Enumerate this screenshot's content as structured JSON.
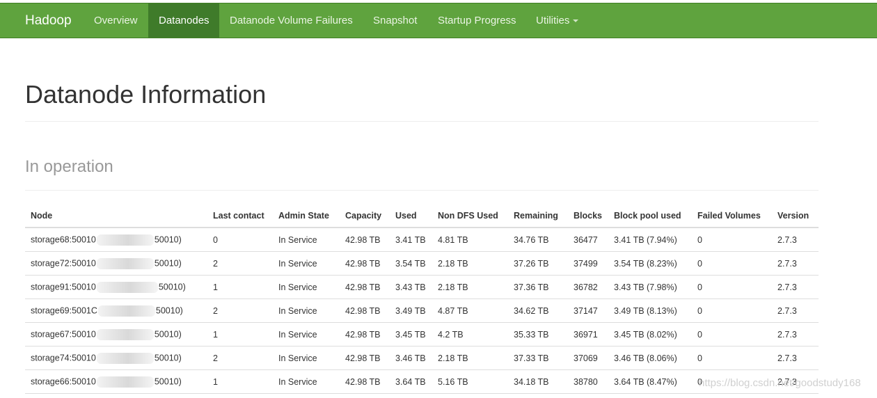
{
  "navbar": {
    "brand": "Hadoop",
    "items": [
      {
        "label": "Overview"
      },
      {
        "label": "Datanodes"
      },
      {
        "label": "Datanode Volume Failures"
      },
      {
        "label": "Snapshot"
      },
      {
        "label": "Startup Progress"
      },
      {
        "label": "Utilities"
      }
    ]
  },
  "page": {
    "title": "Datanode Information",
    "section": "In operation"
  },
  "table": {
    "headers": [
      "Node",
      "Last contact",
      "Admin State",
      "Capacity",
      "Used",
      "Non DFS Used",
      "Remaining",
      "Blocks",
      "Block pool used",
      "Failed Volumes",
      "Version"
    ],
    "rows": [
      {
        "node_prefix": "storage68:50010",
        "node_suffix": "50010)",
        "last_contact": "0",
        "admin_state": "In Service",
        "capacity": "42.98 TB",
        "used": "3.41 TB",
        "non_dfs_used": "4.81 TB",
        "remaining": "34.76 TB",
        "blocks": "36477",
        "block_pool_used": "3.41 TB (7.94%)",
        "failed_volumes": "0",
        "version": "2.7.3"
      },
      {
        "node_prefix": "storage72:50010",
        "node_suffix": "50010)",
        "last_contact": "2",
        "admin_state": "In Service",
        "capacity": "42.98 TB",
        "used": "3.54 TB",
        "non_dfs_used": "2.18 TB",
        "remaining": "37.26 TB",
        "blocks": "37499",
        "block_pool_used": "3.54 TB (8.23%)",
        "failed_volumes": "0",
        "version": "2.7.3"
      },
      {
        "node_prefix": "storage91:50010",
        "node_suffix": "50010)",
        "last_contact": "1",
        "admin_state": "In Service",
        "capacity": "42.98 TB",
        "used": "3.43 TB",
        "non_dfs_used": "2.18 TB",
        "remaining": "37.36 TB",
        "blocks": "36782",
        "block_pool_used": "3.43 TB (7.98%)",
        "failed_volumes": "0",
        "version": "2.7.3"
      },
      {
        "node_prefix": "storage69:5001C",
        "node_suffix": "50010)",
        "last_contact": "2",
        "admin_state": "In Service",
        "capacity": "42.98 TB",
        "used": "3.49 TB",
        "non_dfs_used": "4.87 TB",
        "remaining": "34.62 TB",
        "blocks": "37147",
        "block_pool_used": "3.49 TB (8.13%)",
        "failed_volumes": "0",
        "version": "2.7.3"
      },
      {
        "node_prefix": "storage67:50010",
        "node_suffix": "50010)",
        "last_contact": "1",
        "admin_state": "In Service",
        "capacity": "42.98 TB",
        "used": "3.45 TB",
        "non_dfs_used": "4.2 TB",
        "remaining": "35.33 TB",
        "blocks": "36971",
        "block_pool_used": "3.45 TB (8.02%)",
        "failed_volumes": "0",
        "version": "2.7.3"
      },
      {
        "node_prefix": "storage74:50010",
        "node_suffix": "50010)",
        "last_contact": "2",
        "admin_state": "In Service",
        "capacity": "42.98 TB",
        "used": "3.46 TB",
        "non_dfs_used": "2.18 TB",
        "remaining": "37.33 TB",
        "blocks": "37069",
        "block_pool_used": "3.46 TB (8.06%)",
        "failed_volumes": "0",
        "version": "2.7.3"
      },
      {
        "node_prefix": "storage66:50010",
        "node_suffix": "50010)",
        "last_contact": "1",
        "admin_state": "In Service",
        "capacity": "42.98 TB",
        "used": "3.64 TB",
        "non_dfs_used": "5.16 TB",
        "remaining": "34.18 TB",
        "blocks": "38780",
        "block_pool_used": "3.64 TB (8.47%)",
        "failed_volumes": "0",
        "version": "2.7.3"
      }
    ]
  },
  "watermark": "https://blog.csdn.net/goodstudy168",
  "colors": {
    "navbar": "#5fa33e",
    "navbar_active": "#3f7b2a"
  }
}
